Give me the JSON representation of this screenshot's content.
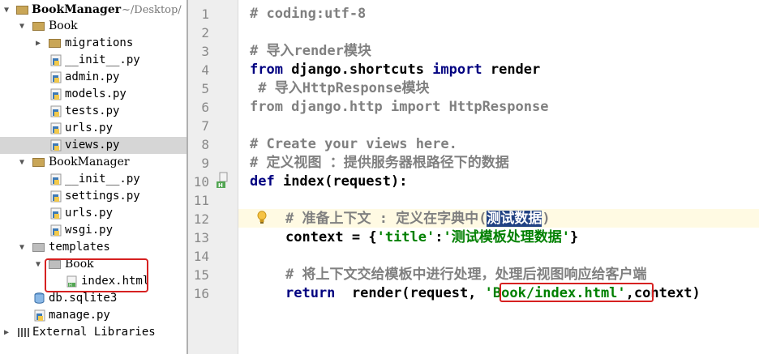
{
  "project_tree": {
    "root": {
      "name": "BookManager",
      "path": "~/Desktop/"
    },
    "items": [
      {
        "label": "Book"
      },
      {
        "label": "migrations"
      },
      {
        "label": "__init__.py"
      },
      {
        "label": "admin.py"
      },
      {
        "label": "models.py"
      },
      {
        "label": "tests.py"
      },
      {
        "label": "urls.py"
      },
      {
        "label": "views.py"
      },
      {
        "label": "BookManager"
      },
      {
        "label": "__init__.py"
      },
      {
        "label": "settings.py"
      },
      {
        "label": "urls.py"
      },
      {
        "label": "wsgi.py"
      },
      {
        "label": "templates"
      },
      {
        "label": "Book"
      },
      {
        "label": "index.html"
      },
      {
        "label": "db.sqlite3"
      },
      {
        "label": "manage.py"
      },
      {
        "label": "External Libraries"
      }
    ]
  },
  "editor": {
    "line_numbers": [
      "1",
      "2",
      "3",
      "4",
      "5",
      "6",
      "7",
      "8",
      "9",
      "10",
      "11",
      "12",
      "13",
      "14",
      "15",
      "16"
    ],
    "lines": {
      "l1": "# coding:utf-8",
      "l3": "# 导入render模块",
      "l4_kw1": "from",
      "l4_mid": " django.shortcuts ",
      "l4_kw2": "import",
      "l4_end": " render",
      "l5": " # 导入HttpResponse模块",
      "l6": "from django.http import HttpResponse",
      "l8": "# Create your views here.",
      "l9": "# 定义视图 ：提供服务器根路径下的数据",
      "l10_kw": "def",
      "l10_rest": " index(request):",
      "l12_pre": "# 准备上下文 : 定义在字典中(",
      "l12_sel": "测试数据",
      "l12_post": ")",
      "l13_a": "context = {",
      "l13_k": "'title'",
      "l13_c": ":",
      "l13_v": "'测试模板处理数据'",
      "l13_e": "}",
      "l15": "# 将上下文交给模板中进行处理，处理后视图响应给客户端",
      "l16_kw": "return",
      "l16_a": "  render(request, ",
      "l16_str": "'Book/index.html'",
      "l16_e": ",context)"
    }
  }
}
